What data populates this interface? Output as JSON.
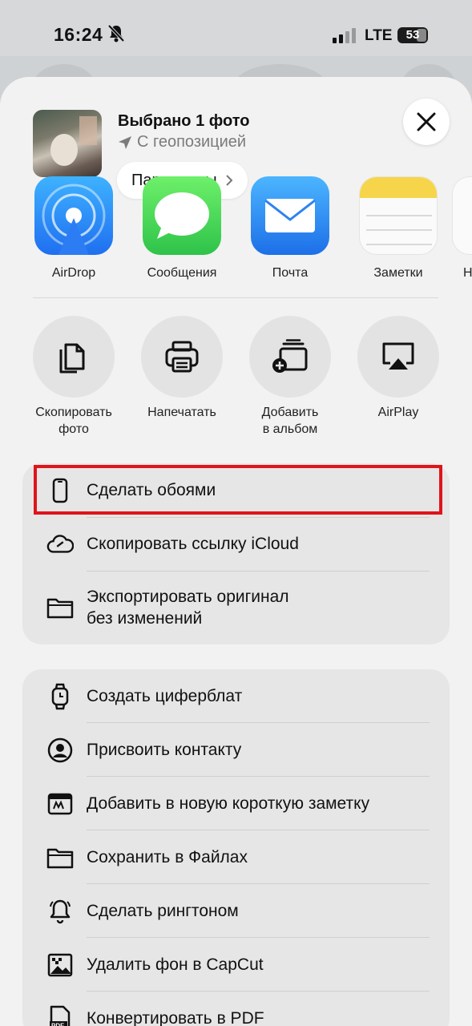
{
  "status_bar": {
    "time": "16:24",
    "network": "LTE",
    "battery": "53"
  },
  "share_header": {
    "title": "Выбрано 1 фото",
    "subtitle": "С геопозицией",
    "options_button": "Параметры"
  },
  "apps": [
    {
      "label": "AirDrop",
      "icon": "airdrop-icon"
    },
    {
      "label": "Сообщения",
      "icon": "messages-icon"
    },
    {
      "label": "Почта",
      "icon": "mail-icon"
    },
    {
      "label": "Заметки",
      "icon": "notes-icon"
    },
    {
      "label": "Н",
      "icon": "app-icon"
    }
  ],
  "actions": [
    {
      "line1": "Скопировать",
      "line2": "фото",
      "icon": "copy-icon"
    },
    {
      "line1": "Напечатать",
      "line2": "",
      "icon": "printer-icon"
    },
    {
      "line1": "Добавить",
      "line2": "в альбом",
      "icon": "add-album-icon"
    },
    {
      "line1": "AirPlay",
      "line2": "",
      "icon": "airplay-icon"
    }
  ],
  "group1": [
    {
      "label": "Сделать обоями",
      "icon": "phone-icon"
    },
    {
      "label": "Скопировать ссылку iCloud",
      "icon": "icloud-link-icon"
    },
    {
      "label1": "Экспортировать оригинал",
      "label2": "без изменений",
      "icon": "folder-icon"
    }
  ],
  "group2": [
    {
      "label": "Создать циферблат",
      "icon": "watch-icon"
    },
    {
      "label": "Присвоить контакту",
      "icon": "contact-icon"
    },
    {
      "label": "Добавить в новую короткую заметку",
      "icon": "quick-note-icon"
    },
    {
      "label": "Сохранить в Файлах",
      "icon": "folder-icon"
    },
    {
      "label": "Сделать рингтоном",
      "icon": "bell-icon"
    },
    {
      "label": "Удалить фон в CapCut",
      "icon": "image-icon"
    },
    {
      "label": "Конвертировать в PDF",
      "icon": "pdf-icon"
    }
  ],
  "colors": {
    "highlight": "#e0141b",
    "sheet": "#f2f2f2",
    "row_group": "#e6e6e6"
  }
}
